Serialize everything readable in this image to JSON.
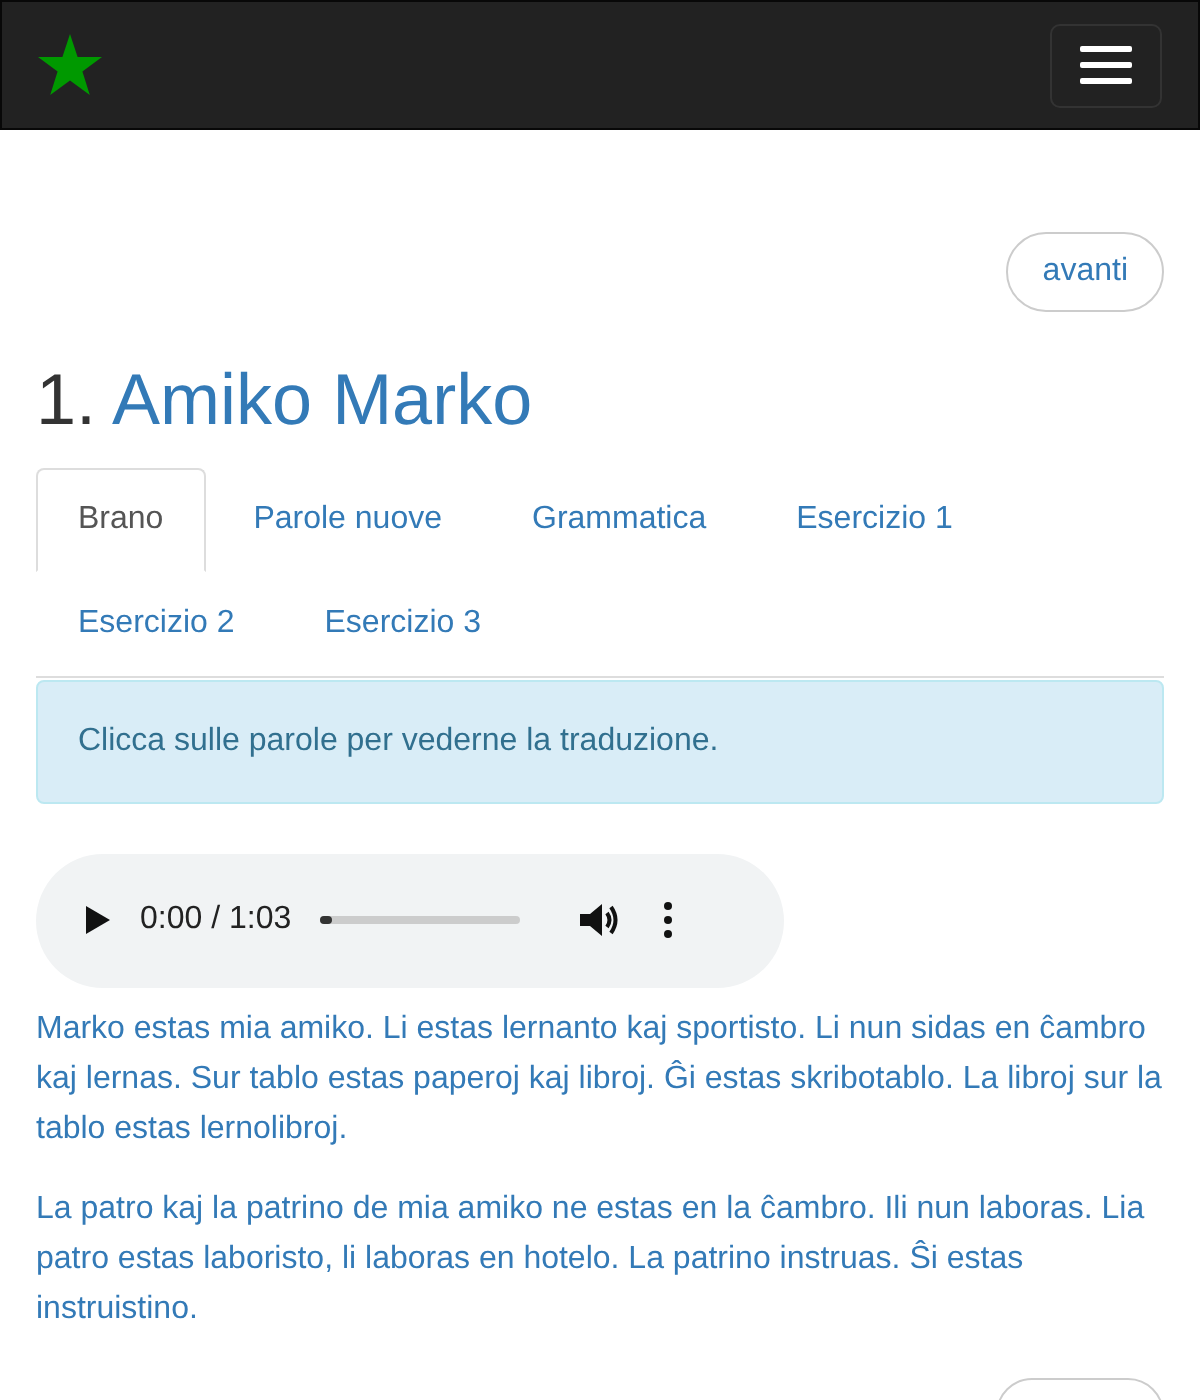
{
  "navbar": {
    "menu_expanded": false
  },
  "pager": {
    "next": "avanti"
  },
  "heading": {
    "number": "1.",
    "title": "Amiko Marko"
  },
  "tabs": [
    {
      "label": "Brano",
      "selected": true
    },
    {
      "label": "Parole nuove",
      "selected": false
    },
    {
      "label": "Grammatica",
      "selected": false
    },
    {
      "label": "Esercizio 1",
      "selected": false
    },
    {
      "label": "Esercizio 2",
      "selected": false
    },
    {
      "label": "Esercizio 3",
      "selected": false
    }
  ],
  "alert": "Clicca sulle parole per vederne la traduzione.",
  "audio": {
    "time": "0:00 / 1:03",
    "level": 0
  },
  "paragraphs": [
    "Marko estas mia amiko. Li estas lernanto kaj sportisto. Li nun sidas en ĉambro kaj lernas. Sur tablo estas paperoj kaj libroj. Ĝi estas skribotablo. La libroj sur la tablo estas lernolibroj.",
    "La patro kaj la patrino de mia amiko ne estas en la ĉambro. Ili nun laboras. Lia patro estas laboristo, li laboras en hotelo. La patrino instruas. Ŝi estas instruistino."
  ]
}
